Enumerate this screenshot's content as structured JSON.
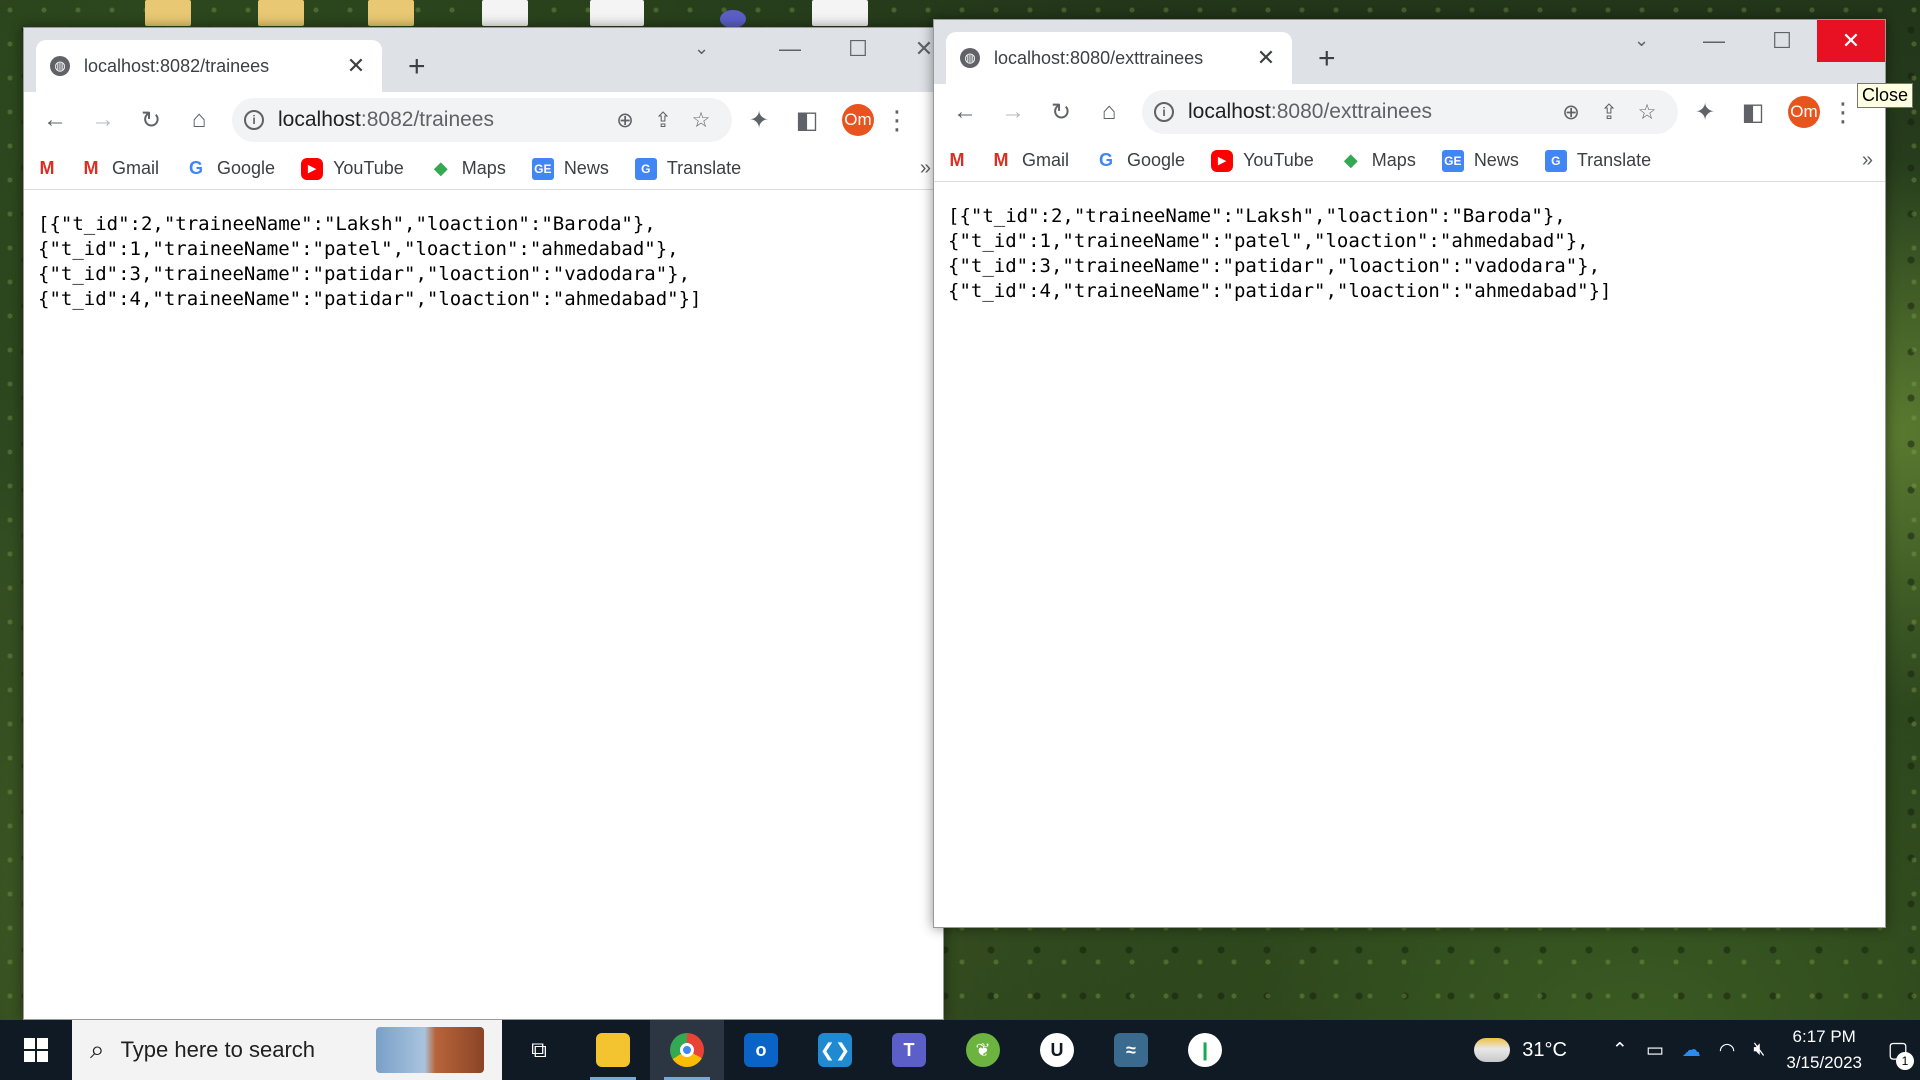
{
  "left_window": {
    "tab_title": "localhost:8082/trainees",
    "url_host": "localhost",
    "url_path": ":8082/trainees",
    "json_lines": [
      "[{\"t_id\":2,\"traineeName\":\"Laksh\",\"loaction\":\"Baroda\"},",
      "{\"t_id\":1,\"traineeName\":\"patel\",\"loaction\":\"ahmedabad\"},",
      "{\"t_id\":3,\"traineeName\":\"patidar\",\"loaction\":\"vadodara\"},",
      "{\"t_id\":4,\"traineeName\":\"patidar\",\"loaction\":\"ahmedabad\"}]"
    ]
  },
  "right_window": {
    "tab_title": "localhost:8080/exttrainees",
    "url_host": "localhost",
    "url_path": ":8080/exttrainees",
    "json_lines": [
      "[{\"t_id\":2,\"traineeName\":\"Laksh\",\"loaction\":\"Baroda\"},",
      "{\"t_id\":1,\"traineeName\":\"patel\",\"loaction\":\"ahmedabad\"},",
      "{\"t_id\":3,\"traineeName\":\"patidar\",\"loaction\":\"vadodara\"},",
      "{\"t_id\":4,\"traineeName\":\"patidar\",\"loaction\":\"ahmedabad\"}]"
    ]
  },
  "profile_initials": "Om",
  "bookmarks": [
    {
      "label": "",
      "icon": "gmail-icon"
    },
    {
      "label": "Gmail",
      "icon": "gmail-icon"
    },
    {
      "label": "Google",
      "icon": "google-icon"
    },
    {
      "label": "YouTube",
      "icon": "youtube-icon"
    },
    {
      "label": "Maps",
      "icon": "maps-icon"
    },
    {
      "label": "News",
      "icon": "news-icon"
    },
    {
      "label": "Translate",
      "icon": "translate-icon"
    }
  ],
  "tooltip": "Close",
  "taskbar": {
    "search_placeholder": "Type here to search",
    "weather_temp": "31°C",
    "time": "6:17 PM",
    "date": "3/15/2023",
    "notification_count": "1"
  },
  "colors": {
    "accent_orange": "#e8541e",
    "close_red": "#e81123",
    "taskbar": "#101a24"
  }
}
